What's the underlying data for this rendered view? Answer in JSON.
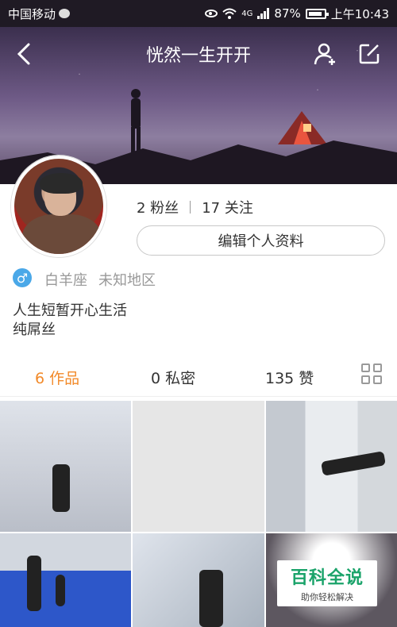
{
  "status_bar": {
    "carrier": "中国移动",
    "network": "4G",
    "battery": "87%",
    "time": "上午10:43"
  },
  "header": {
    "title": "恍然一生开开"
  },
  "profile": {
    "followers": "2 粉丝",
    "following": "17 关注",
    "edit_button": "编辑个人资料",
    "gender_symbol": "♂",
    "constellation": "白羊座",
    "region": "未知地区",
    "bio_line1": "人生短暂开心生活",
    "bio_line2": "纯屌丝"
  },
  "tabs": [
    {
      "label": "6 作品",
      "active": true
    },
    {
      "label": "0 私密",
      "active": false
    },
    {
      "label": "135 赞",
      "active": false
    }
  ],
  "watermark": {
    "title": "百科全说",
    "subtitle": "助你轻松解决"
  },
  "colors": {
    "accent": "#f28a2a",
    "gender_blue": "#4aa8e8",
    "watermark_green": "#1aa36a"
  }
}
